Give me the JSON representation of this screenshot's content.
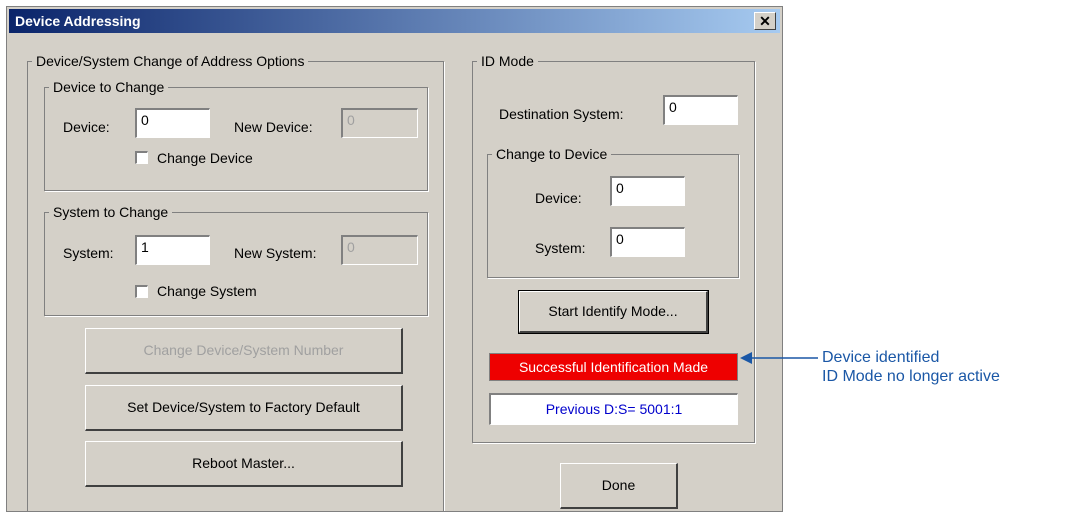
{
  "window": {
    "title": "Device Addressing",
    "close_glyph": "✕"
  },
  "change_options": {
    "legend": "Device/System Change of Address Options",
    "device_group": {
      "legend": "Device to Change",
      "device_label": "Device:",
      "device_value": "0",
      "new_device_label": "New Device:",
      "new_device_value": "0",
      "checkbox_label": "Change Device",
      "checked": false
    },
    "system_group": {
      "legend": "System to Change",
      "system_label": "System:",
      "system_value": "1",
      "new_system_label": "New System:",
      "new_system_value": "0",
      "checkbox_label": "Change System",
      "checked": false
    },
    "change_number_button": "Change Device/System Number",
    "factory_default_button": "Set Device/System to Factory Default",
    "reboot_button": "Reboot Master..."
  },
  "id_mode": {
    "legend": "ID Mode",
    "destination_label": "Destination System:",
    "destination_value": "0",
    "change_to_device": {
      "legend": "Change to Device",
      "device_label": "Device:",
      "device_value": "0",
      "system_label": "System:",
      "system_value": "0"
    },
    "start_button": "Start Identify Mode...",
    "status_text": "Successful Identification Made",
    "status_color": "#ee0000",
    "previous_text": "Previous D:S= 5001:1"
  },
  "done_button": "Done",
  "annotation": {
    "line1": "Device identified",
    "line2": "ID Mode no longer active",
    "color": "#1a57a6"
  }
}
